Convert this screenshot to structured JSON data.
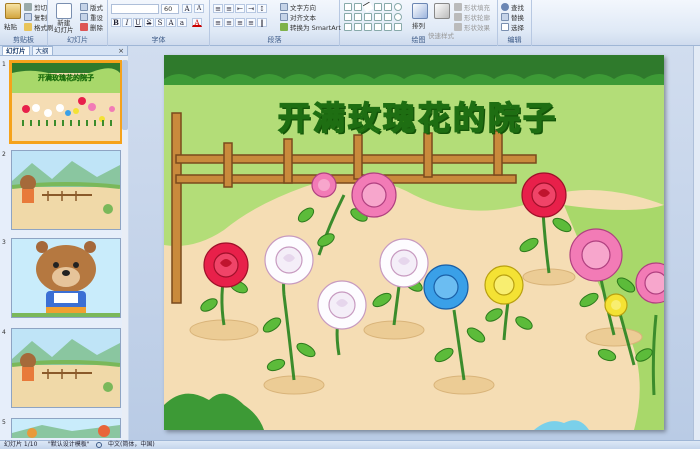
{
  "ribbon": {
    "clipboard": {
      "label": "剪贴板",
      "paste": "粘贴",
      "cut": "剪切",
      "copy": "复制",
      "format_painter": "格式刷"
    },
    "slides": {
      "label": "幻灯片",
      "new_slide": "新建\n幻灯片",
      "layout": "版式",
      "reset": "重设",
      "delete": "删除"
    },
    "font": {
      "label": "字体",
      "font_name": "",
      "font_size": "60"
    },
    "paragraph": {
      "label": "段落",
      "text_direction": "文字方向",
      "align_text": "对齐文本",
      "smartart": "转换为 SmartArt"
    },
    "drawing": {
      "label": "绘图",
      "arrange": "排列",
      "quick_styles": "快速样式",
      "shape_fill": "形状填充",
      "shape_outline": "形状轮廓",
      "shape_effects": "形状效果"
    },
    "editing": {
      "label": "编辑",
      "find": "查找",
      "replace": "替换",
      "select": "选择"
    }
  },
  "left_panel": {
    "tabs": [
      "幻灯片",
      "大纲"
    ],
    "close": "×",
    "slides": [
      {
        "number": "1",
        "selected": true
      },
      {
        "number": "2",
        "selected": false
      },
      {
        "number": "3",
        "selected": false
      },
      {
        "number": "4",
        "selected": false
      },
      {
        "number": "5",
        "selected": false
      }
    ]
  },
  "slide": {
    "title": "开满玫瑰花的院子"
  },
  "status": {
    "slide_counter": "幻灯片 1/10",
    "theme": "\"默认设计模板\"",
    "language": "中文(简体，中国)"
  },
  "colors": {
    "ribbon_bg": "#dfe9f6",
    "selection": "#f5a21b",
    "title_fill": "#7dd31f",
    "title_outline": "#1e6e12"
  }
}
